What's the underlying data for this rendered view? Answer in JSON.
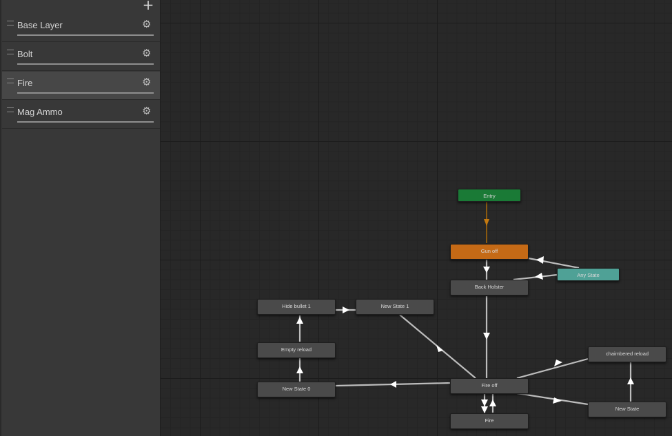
{
  "layers_panel": {
    "add_icon": "plus-icon",
    "layers": [
      {
        "name": "Base Layer",
        "selected": false
      },
      {
        "name": "Bolt",
        "selected": false
      },
      {
        "name": "Fire",
        "selected": true
      },
      {
        "name": "Mag Ammo",
        "selected": false
      }
    ],
    "settings_icon": "gear-icon"
  },
  "graph": {
    "states": {
      "entry": "Entry",
      "gun_off": "Gun off",
      "any_state": "Any State",
      "back_holster": "Back Holster",
      "hide_bullet_1": "Hide bullet 1",
      "new_state_1": "New State 1",
      "empty_reload": "Empty reload",
      "new_state_0": "New State 0",
      "fire_off": "Fire off",
      "fire": "Fire",
      "chaimbered_reload": "chaimbered reload",
      "new_state": "New State"
    },
    "colors": {
      "entry": "#1a7a36",
      "default_state": "#c56a16",
      "any_state": "#4fa196",
      "state": "#4a4a4a",
      "entry_transition": "#c57a10",
      "transition": "#bdbdbd"
    }
  }
}
